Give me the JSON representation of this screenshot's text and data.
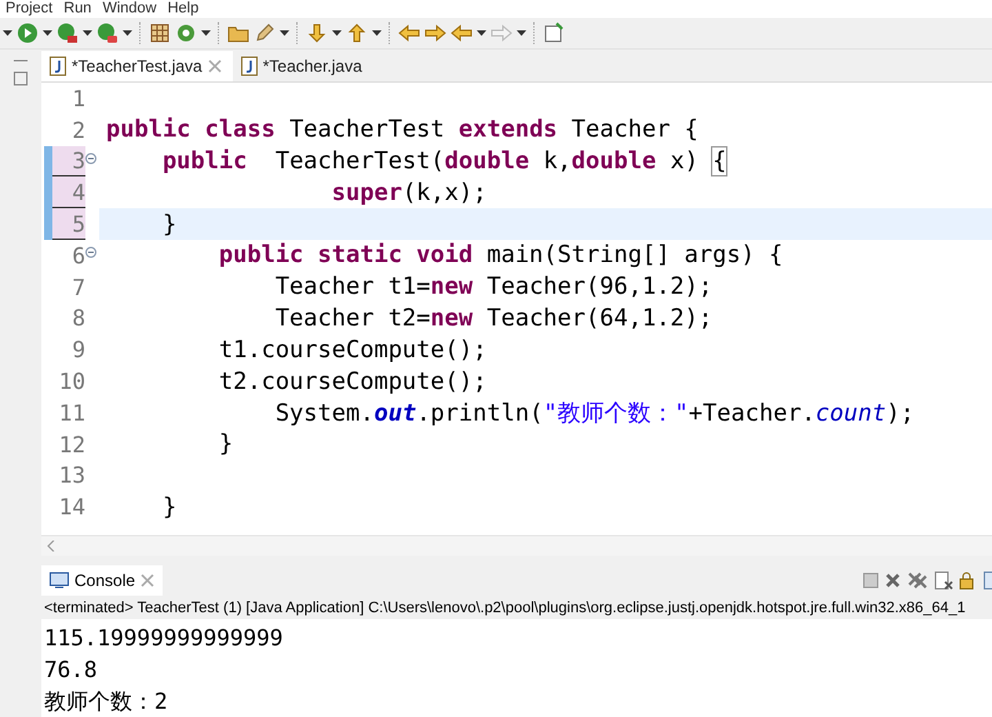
{
  "menu_bar": {
    "items": [
      "Project",
      "Run",
      "Window",
      "Help"
    ]
  },
  "editor_tabs": [
    {
      "label": "*TeacherTest.java",
      "selected": true,
      "closable": true
    },
    {
      "label": "*Teacher.java",
      "selected": false,
      "closable": false
    }
  ],
  "editor": {
    "lines": [
      {
        "number": "1",
        "changed": false,
        "current": false,
        "fold": false
      },
      {
        "number": "2",
        "changed": false,
        "current": false,
        "fold": false,
        "tokens": [
          {
            "kind": "keyword",
            "t": "public class"
          },
          {
            "kind": "plain",
            "t": " TeacherTest "
          },
          {
            "kind": "keyword",
            "t": "extends"
          },
          {
            "kind": "plain",
            "t": " Teacher {"
          }
        ]
      },
      {
        "number": "3",
        "changed": true,
        "current": false,
        "fold": true,
        "tokens": [
          {
            "kind": "keyword",
            "t": "    public"
          },
          {
            "kind": "plain",
            "t": "  TeacherTest("
          },
          {
            "kind": "keyword",
            "t": "double"
          },
          {
            "kind": "plain",
            "t": " k,"
          },
          {
            "kind": "keyword",
            "t": "double"
          },
          {
            "kind": "plain",
            "t": " x) "
          },
          {
            "kind": "match",
            "t": "{"
          }
        ]
      },
      {
        "number": "4",
        "changed": true,
        "current": false,
        "fold": false,
        "tokens": [
          {
            "kind": "keyword",
            "t": "                super"
          },
          {
            "kind": "plain",
            "t": "(k,x);"
          }
        ]
      },
      {
        "number": "5",
        "changed": true,
        "current": true,
        "fold": false,
        "tokens": [
          {
            "kind": "plain",
            "t": "    }"
          }
        ]
      },
      {
        "number": "6",
        "changed": false,
        "current": false,
        "fold": true,
        "tokens": [
          {
            "kind": "keyword",
            "t": "        public static void"
          },
          {
            "kind": "plain",
            "t": " main(String[] args) {"
          }
        ]
      },
      {
        "number": "7",
        "changed": false,
        "current": false,
        "fold": false,
        "tokens": [
          {
            "kind": "plain",
            "t": "            Teacher t1="
          },
          {
            "kind": "keyword",
            "t": "new"
          },
          {
            "kind": "plain",
            "t": " Teacher(96,1.2);"
          }
        ]
      },
      {
        "number": "8",
        "changed": false,
        "current": false,
        "fold": false,
        "tokens": [
          {
            "kind": "plain",
            "t": "            Teacher t2="
          },
          {
            "kind": "keyword",
            "t": "new"
          },
          {
            "kind": "plain",
            "t": " Teacher(64,1.2);"
          }
        ]
      },
      {
        "number": "9",
        "changed": false,
        "current": false,
        "fold": false,
        "tokens": [
          {
            "kind": "plain",
            "t": "        t1.courseCompute();"
          }
        ]
      },
      {
        "number": "10",
        "changed": false,
        "current": false,
        "fold": false,
        "tokens": [
          {
            "kind": "plain",
            "t": "        t2.courseCompute();"
          }
        ]
      },
      {
        "number": "11",
        "changed": false,
        "current": false,
        "fold": false,
        "tokens": [
          {
            "kind": "plain",
            "t": "            System."
          },
          {
            "kind": "static_field",
            "t": "out"
          },
          {
            "kind": "plain",
            "t": ".println("
          },
          {
            "kind": "string",
            "t": "\"教师个数：\""
          },
          {
            "kind": "plain",
            "t": "+Teacher."
          },
          {
            "kind": "field",
            "t": "count"
          },
          {
            "kind": "plain",
            "t": ");"
          }
        ]
      },
      {
        "number": "12",
        "changed": false,
        "current": false,
        "fold": false,
        "tokens": [
          {
            "kind": "plain",
            "t": "        }"
          }
        ]
      },
      {
        "number": "13",
        "changed": false,
        "current": false,
        "fold": false
      },
      {
        "number": "14",
        "changed": false,
        "current": false,
        "fold": false,
        "tokens": [
          {
            "kind": "plain",
            "t": "    }"
          }
        ]
      }
    ]
  },
  "console": {
    "tab": {
      "label": "Console",
      "selected": true
    },
    "status": "<terminated> TeacherTest (1) [Java Application] C:\\Users\\lenovo\\.p2\\pool\\plugins\\org.eclipse.justj.openjdk.hotspot.jre.full.win32.x86_64_1",
    "output": [
      "115.19999999999999",
      "76.8",
      "教师个数：2"
    ]
  }
}
